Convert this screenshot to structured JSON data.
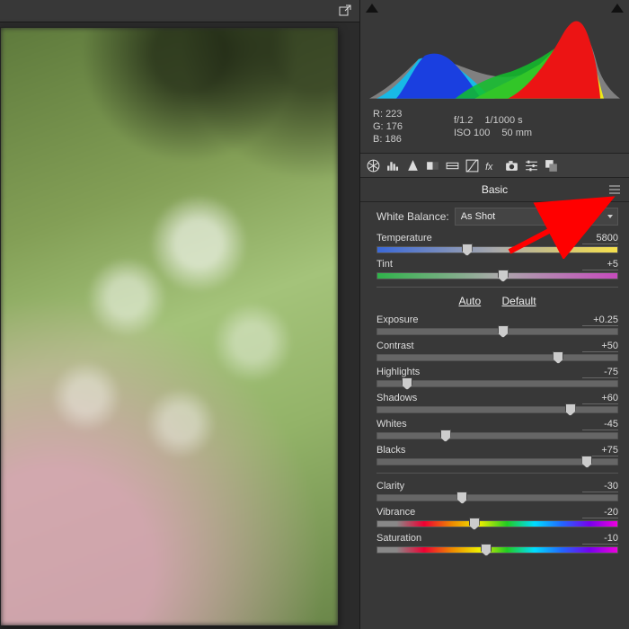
{
  "icons": {
    "export": "export-icon",
    "panelMenu": "panel-menu-icon"
  },
  "info": {
    "r_label": "R:",
    "r_value": "223",
    "g_label": "G:",
    "g_value": "176",
    "b_label": "B:",
    "b_value": "186",
    "aperture": "f/1.2",
    "shutter": "1/1000 s",
    "iso": "ISO 100",
    "focal": "50 mm"
  },
  "toolstrip": [
    "aperture-icon",
    "histogram-icon",
    "sharpen-icon",
    "gradient-icon",
    "lut-icon",
    "tonecurve-icon",
    "fx-icon",
    "camera-icon",
    "sliders-icon",
    "overlap-icon"
  ],
  "panel": {
    "title": "Basic",
    "white_balance_label": "White Balance:",
    "white_balance_value": "As Shot",
    "auto": "Auto",
    "default": "Default"
  },
  "sliders": {
    "temperature": {
      "label": "Temperature",
      "value": "5800",
      "pos": 37
    },
    "tint": {
      "label": "Tint",
      "value": "+5",
      "pos": 52
    },
    "exposure": {
      "label": "Exposure",
      "value": "+0.25",
      "pos": 52
    },
    "contrast": {
      "label": "Contrast",
      "value": "+50",
      "pos": 75
    },
    "highlights": {
      "label": "Highlights",
      "value": "-75",
      "pos": 12
    },
    "shadows": {
      "label": "Shadows",
      "value": "+60",
      "pos": 80
    },
    "whites": {
      "label": "Whites",
      "value": "-45",
      "pos": 28
    },
    "blacks": {
      "label": "Blacks",
      "value": "+75",
      "pos": 87
    },
    "clarity": {
      "label": "Clarity",
      "value": "-30",
      "pos": 35
    },
    "vibrance": {
      "label": "Vibrance",
      "value": "-20",
      "pos": 40
    },
    "saturation": {
      "label": "Saturation",
      "value": "-10",
      "pos": 45
    }
  }
}
